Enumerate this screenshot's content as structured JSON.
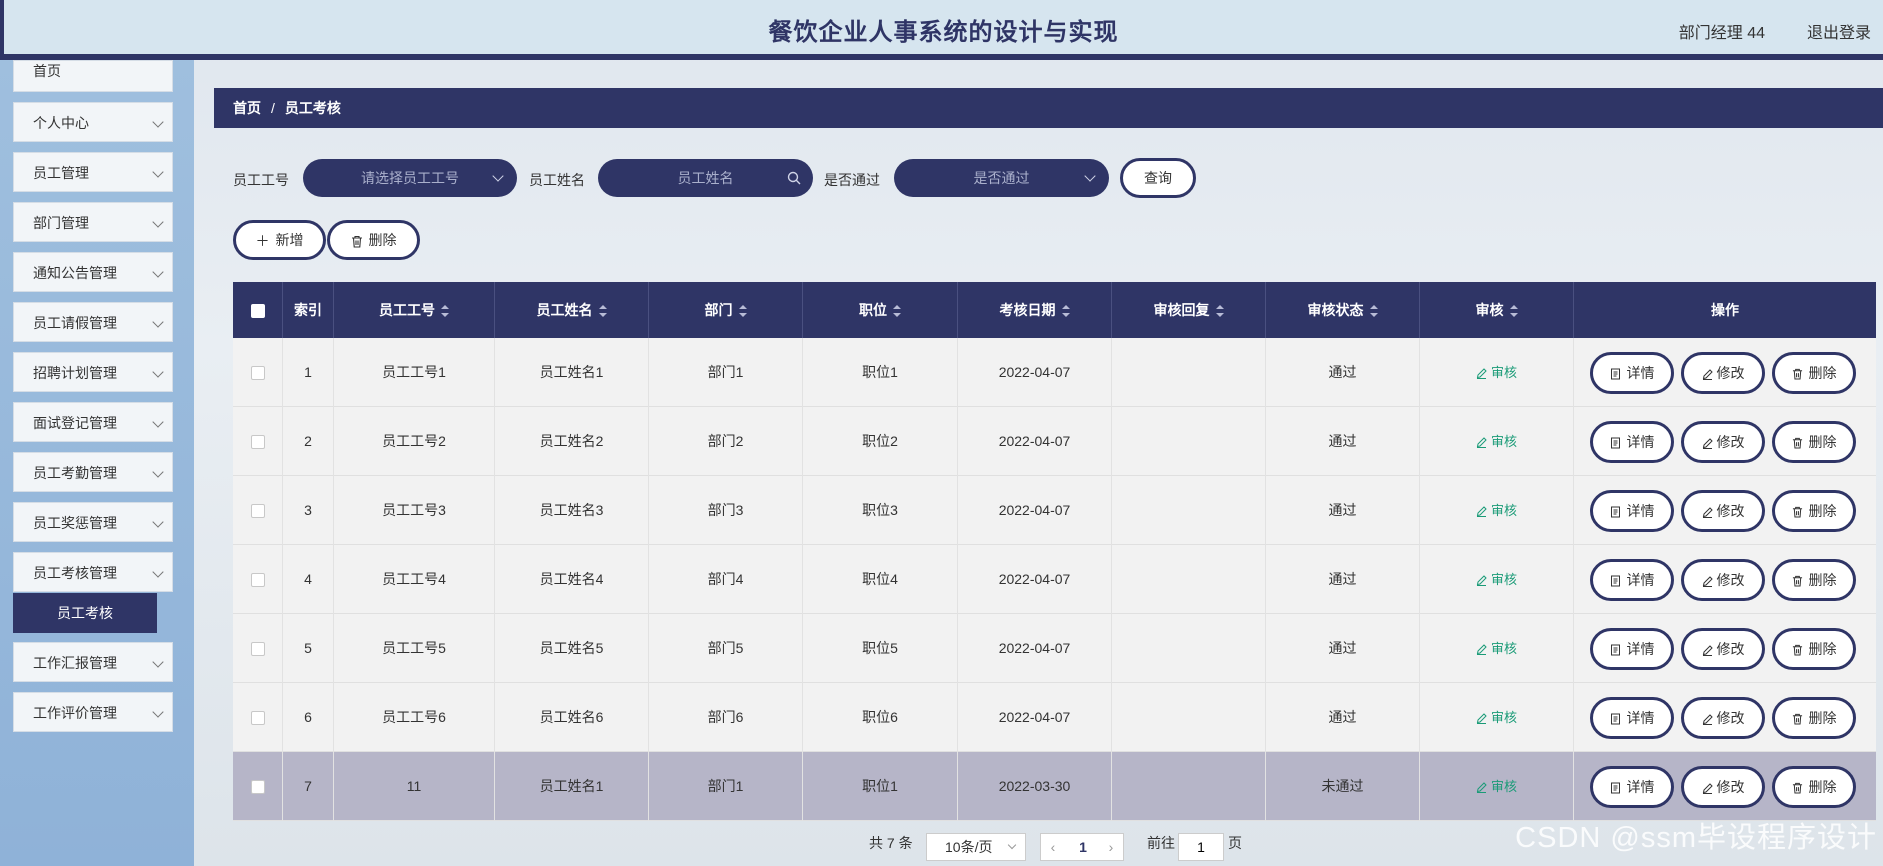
{
  "header": {
    "title": "餐饮企业人事系统的设计与实现",
    "user": "部门经理 44",
    "logout": "退出登录"
  },
  "sidebar": {
    "items": [
      {
        "label": "首页"
      },
      {
        "label": "个人中心"
      },
      {
        "label": "员工管理"
      },
      {
        "label": "部门管理"
      },
      {
        "label": "通知公告管理"
      },
      {
        "label": "员工请假管理"
      },
      {
        "label": "招聘计划管理"
      },
      {
        "label": "面试登记管理"
      },
      {
        "label": "员工考勤管理"
      },
      {
        "label": "员工奖惩管理"
      },
      {
        "label": "员工考核管理"
      },
      {
        "label": "工作汇报管理"
      },
      {
        "label": "工作评价管理"
      }
    ],
    "active_sub": "员工考核"
  },
  "breadcrumb": {
    "home": "首页",
    "sep": "/",
    "current": "员工考核"
  },
  "search": {
    "emp_no_label": "员工工号",
    "emp_no_placeholder": "请选择员工工号",
    "emp_name_label": "员工姓名",
    "emp_name_placeholder": "员工姓名",
    "passed_label": "是否通过",
    "passed_placeholder": "是否通过",
    "query": "查询"
  },
  "toolbar": {
    "add": "新增",
    "delete": "删除"
  },
  "table": {
    "headers": [
      "索引",
      "员工工号",
      "员工姓名",
      "部门",
      "职位",
      "考核日期",
      "审核回复",
      "审核状态",
      "审核",
      "操作"
    ],
    "audit_label": "审核",
    "actions": {
      "detail": "详情",
      "edit": "修改",
      "delete": "删除"
    },
    "rows": [
      {
        "index": "1",
        "emp_no": "员工工号1",
        "name": "员工姓名1",
        "dept": "部门1",
        "position": "职位1",
        "date": "2022-04-07",
        "reply": "",
        "status": "通过"
      },
      {
        "index": "2",
        "emp_no": "员工工号2",
        "name": "员工姓名2",
        "dept": "部门2",
        "position": "职位2",
        "date": "2022-04-07",
        "reply": "",
        "status": "通过"
      },
      {
        "index": "3",
        "emp_no": "员工工号3",
        "name": "员工姓名3",
        "dept": "部门3",
        "position": "职位3",
        "date": "2022-04-07",
        "reply": "",
        "status": "通过"
      },
      {
        "index": "4",
        "emp_no": "员工工号4",
        "name": "员工姓名4",
        "dept": "部门4",
        "position": "职位4",
        "date": "2022-04-07",
        "reply": "",
        "status": "通过"
      },
      {
        "index": "5",
        "emp_no": "员工工号5",
        "name": "员工姓名5",
        "dept": "部门5",
        "position": "职位5",
        "date": "2022-04-07",
        "reply": "",
        "status": "通过"
      },
      {
        "index": "6",
        "emp_no": "员工工号6",
        "name": "员工姓名6",
        "dept": "部门6",
        "position": "职位6",
        "date": "2022-04-07",
        "reply": "",
        "status": "通过"
      },
      {
        "index": "7",
        "emp_no": "11",
        "name": "员工姓名1",
        "dept": "部门1",
        "position": "职位1",
        "date": "2022-03-30",
        "reply": "",
        "status": "未通过"
      }
    ]
  },
  "pagination": {
    "total": "共 7 条",
    "page_size": "10条/页",
    "current": "1",
    "goto_label": "前往",
    "goto_value": "1",
    "page_unit": "页"
  },
  "watermark": "CSDN @ssm毕设程序设计"
}
